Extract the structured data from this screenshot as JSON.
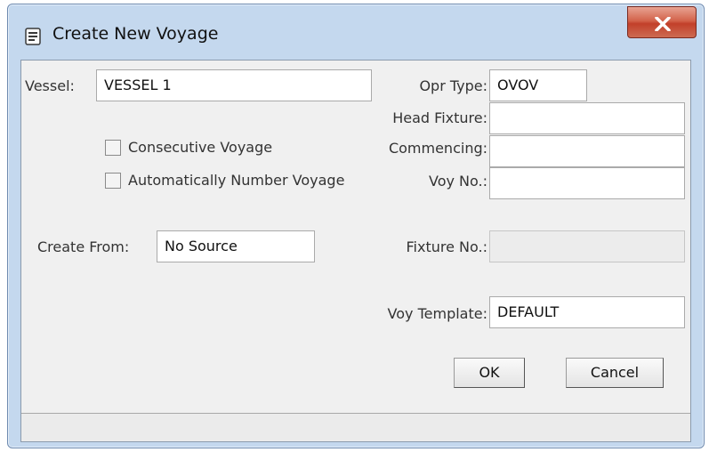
{
  "window": {
    "title": "Create New Voyage",
    "close_glyph": "X",
    "icon": "dialog-form-icon"
  },
  "form": {
    "vessel": {
      "label": "Vessel:",
      "value": "VESSEL 1"
    },
    "opr_type": {
      "label": "Opr Type:",
      "value": "OVOV"
    },
    "head_fixture": {
      "label": "Head Fixture:",
      "value": ""
    },
    "consecutive_voyage": {
      "label": "Consecutive Voyage",
      "checked": false
    },
    "commencing": {
      "label": "Commencing:",
      "value": ""
    },
    "auto_number": {
      "label": "Automatically Number Voyage",
      "checked": false
    },
    "voy_no": {
      "label": "Voy No.:",
      "value": ""
    },
    "create_from": {
      "label": "Create From:",
      "value": "No Source"
    },
    "fixture_no": {
      "label": "Fixture No.:",
      "value": "",
      "disabled": true
    },
    "voy_template": {
      "label": "Voy Template:",
      "value": "DEFAULT"
    }
  },
  "buttons": {
    "ok": "OK",
    "cancel": "Cancel"
  },
  "status_bar": {
    "text": ""
  }
}
